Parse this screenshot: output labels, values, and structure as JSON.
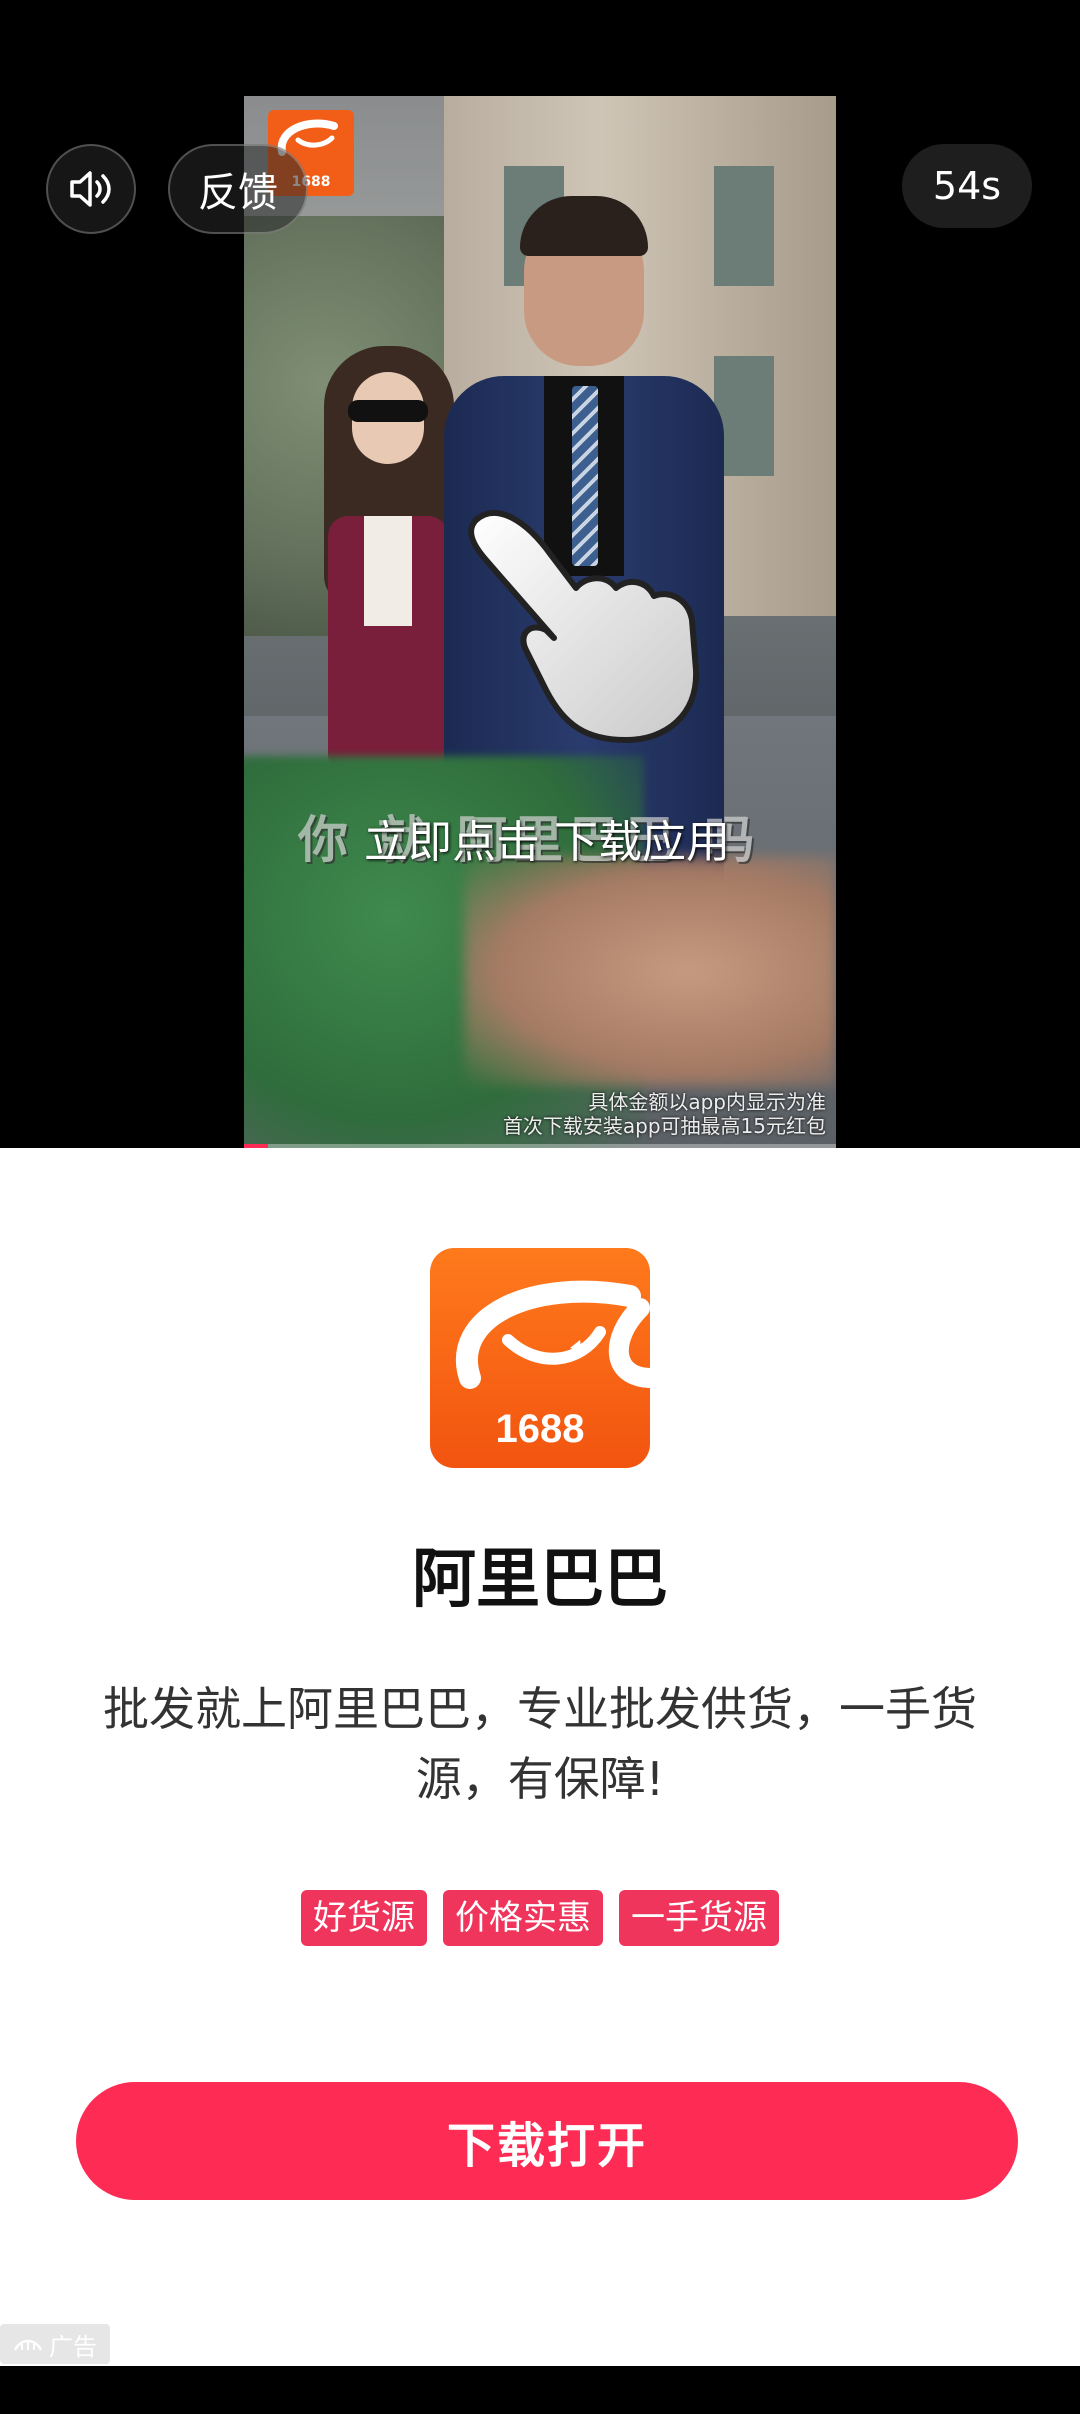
{
  "video": {
    "logo_text": "1688",
    "subtitle_bg": "你 就 阿里巴巴 吗",
    "cta_text": "立即点击 下载应用",
    "disclaimer_line1": "具体金额以app内显示为准",
    "disclaimer_line2": "首次下载安装app可抽最高15元红包",
    "progress_fraction": 0.04
  },
  "controls": {
    "sound_icon": "speaker-icon",
    "feedback_label": "反馈",
    "timer_label": "54s"
  },
  "card": {
    "app_icon_text": "1688",
    "app_name": "阿里巴巴",
    "description": "批发就上阿里巴巴，专业批发供货，一手货源，有保障!",
    "tags": [
      "好货源",
      "价格实惠",
      "一手货源"
    ],
    "download_label": "下载打开",
    "ad_label": "广告"
  },
  "colors": {
    "accent": "#fe2c55",
    "tag": "#f0355c",
    "brand_orange": "#f25410"
  }
}
